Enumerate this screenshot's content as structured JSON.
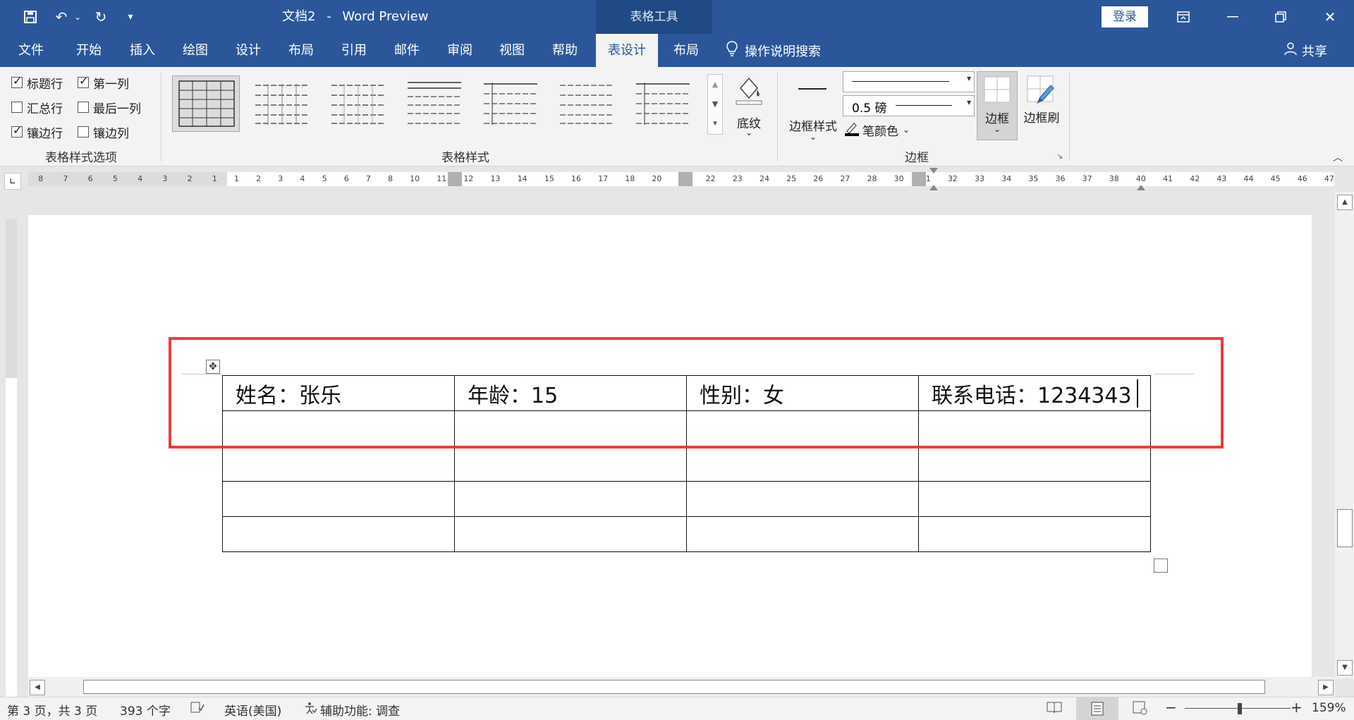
{
  "titlebar": {
    "doc_name": "文档2",
    "sep": "-",
    "app_name": "Word Preview",
    "context_tool": "表格工具",
    "login": "登录"
  },
  "quick_access": {
    "customize": "▾"
  },
  "menu": {
    "tabs": [
      "文件",
      "开始",
      "插入",
      "绘图",
      "设计",
      "布局",
      "引用",
      "邮件",
      "审阅",
      "视图",
      "帮助",
      "表设计",
      "布局"
    ],
    "search": "操作说明搜索",
    "share": "共享"
  },
  "ribbon": {
    "style_options": {
      "items": [
        {
          "label": "标题行",
          "checked": true
        },
        {
          "label": "第一列",
          "checked": true
        },
        {
          "label": "汇总行",
          "checked": false
        },
        {
          "label": "最后一列",
          "checked": false
        },
        {
          "label": "镶边行",
          "checked": true
        },
        {
          "label": "镶边列",
          "checked": false
        }
      ],
      "group_label": "表格样式选项"
    },
    "table_styles": {
      "group_label": "表格样式"
    },
    "shading": {
      "label": "底纹"
    },
    "borders": {
      "border_styles": "边框样式",
      "weight": "0.5 磅",
      "pen_color": "笔颜色",
      "borders_label": "边框",
      "painter": "边框刷",
      "group_label": "边框"
    }
  },
  "ruler": {
    "left_numbers": [
      "8",
      "7",
      "6",
      "5",
      "4",
      "3",
      "2",
      "1"
    ],
    "right_numbers": [
      "1",
      "2",
      "3",
      "4",
      "5",
      "6",
      "7",
      "8",
      "10",
      "11",
      "12",
      "13",
      "14",
      "15",
      "16",
      "17",
      "18",
      "20",
      "21",
      "22",
      "23",
      "24",
      "25",
      "26",
      "27",
      "28",
      "30",
      "31",
      "32",
      "33",
      "34",
      "35",
      "36",
      "37",
      "38",
      "40",
      "41",
      "42",
      "43",
      "44",
      "45",
      "46",
      "47"
    ]
  },
  "document": {
    "table": [
      [
        "姓名：张乐",
        "年龄：15",
        "性别：女",
        "联系电话：1234343"
      ],
      [
        "",
        "",
        "",
        ""
      ],
      [
        "",
        "",
        "",
        ""
      ],
      [
        "",
        "",
        "",
        ""
      ],
      [
        "",
        "",
        "",
        ""
      ]
    ]
  },
  "status": {
    "page": "第 3 页，共 3 页",
    "words": "393 个字",
    "language": "英语(美国)",
    "accessibility": "辅助功能: 调查",
    "zoom": "159%"
  },
  "colors": {
    "accent": "#2b579a",
    "highlight": "#ec3b3b"
  }
}
